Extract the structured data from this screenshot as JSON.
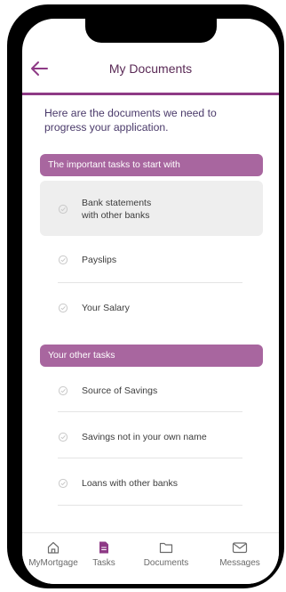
{
  "header": {
    "title": "My Documents",
    "back_icon": "arrow-left-icon"
  },
  "intro_text": "Here are the documents we need to progress your application.",
  "sections": [
    {
      "title": "The important tasks to start with",
      "tasks": [
        {
          "line1": "Bank statements",
          "line2": "with other banks"
        },
        {
          "line1": "Payslips"
        },
        {
          "line1": "Your Salary"
        }
      ]
    },
    {
      "title": "Your other tasks",
      "tasks": [
        {
          "line1": "Source of Savings"
        },
        {
          "line1": "Savings not in your own name"
        },
        {
          "line1": "Loans with other banks"
        }
      ]
    }
  ],
  "bottom_nav": [
    {
      "label": "MyMortgage",
      "icon": "home-icon"
    },
    {
      "label": "Tasks",
      "icon": "document-icon",
      "active": true
    },
    {
      "label": "Documents",
      "icon": "folder-icon"
    },
    {
      "label": "Messages",
      "icon": "mail-icon"
    }
  ],
  "colors": {
    "accent": "#8e3a86",
    "section_bar": "#a8669f",
    "highlight_row": "#eeeeee"
  }
}
